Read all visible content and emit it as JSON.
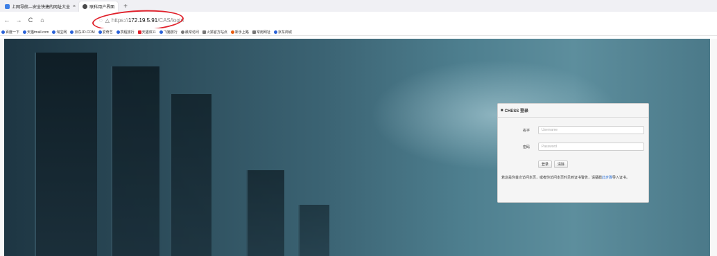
{
  "tabs": [
    {
      "label": "上网导航—安全快捷的网址大全",
      "icon": "site-favicon",
      "color": "#3d7fe6",
      "active": false,
      "close": "×"
    },
    {
      "label": "联科用户界面",
      "icon": "edge-favicon",
      "color": "#4a4a4a",
      "active": true,
      "close": ""
    }
  ],
  "new_tab": "+",
  "nav": {
    "back": "←",
    "forward": "→",
    "reload": "C",
    "home": "⌂"
  },
  "address": {
    "shield": "◌",
    "lock": "🔒",
    "scheme": "https://",
    "host": "172.19.5.91",
    "path": "/CAS/login"
  },
  "bookmarks": [
    {
      "label": "百度一下",
      "color": "#2a62d8"
    },
    {
      "label": "天猫tmall.com",
      "color": "#2a62d8"
    },
    {
      "label": "淘宝网",
      "color": "#2a62d8"
    },
    {
      "label": "京东JD.COM",
      "color": "#2a62d8"
    },
    {
      "label": "爱奇艺",
      "color": "#2a62d8"
    },
    {
      "label": "携程旅行",
      "color": "#2a62d8"
    },
    {
      "label": "天猫双11",
      "color": "#e0202a"
    },
    {
      "label": "飞猪旅行",
      "color": "#2a62d8"
    },
    {
      "label": "最常访问",
      "color": "#777777"
    },
    {
      "label": "火狐官方站点",
      "color": "#777777"
    },
    {
      "label": "新手上路",
      "color": "#e85d10"
    },
    {
      "label": "常用网址",
      "color": "#777777"
    },
    {
      "label": "京东商城",
      "color": "#2a62d8"
    }
  ],
  "login": {
    "title": "CHESS 登录",
    "username_label": "名字",
    "username_placeholder": "Username",
    "password_label": "密码",
    "password_placeholder": "Password",
    "submit": "登录",
    "clear": "清除",
    "note_before": "若这是你首次访问本页，或者你访问本页时见到证书警告，请猛戳",
    "note_link": "此步骤",
    "note_after": "导入证书。"
  }
}
